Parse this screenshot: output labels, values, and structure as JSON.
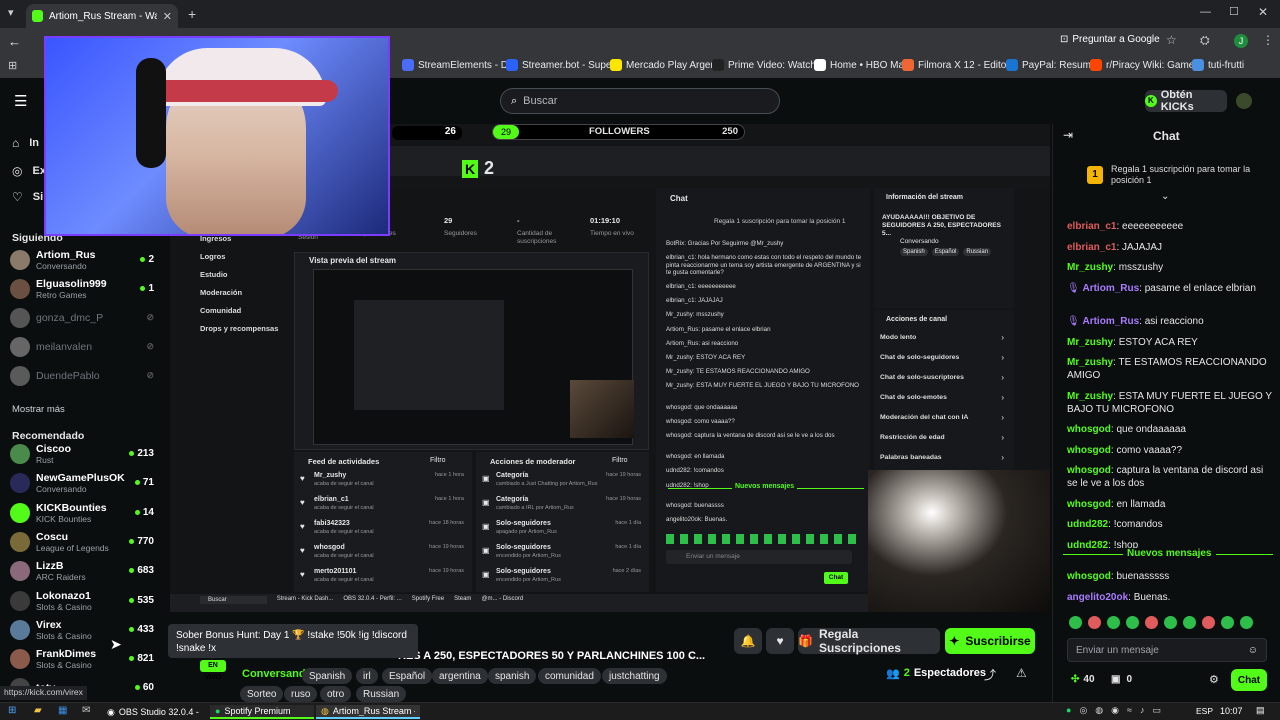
{
  "browser": {
    "tab_title": "Artiom_Rus Stream - Watch Liv",
    "ask_google": "Preguntar a Google",
    "bookmarks": [
      "StreamElements - D...",
      "Streamer.bot - Supe...",
      "Mercado Play Argen...",
      "Prime Video: Watch...",
      "Home • HBO Max",
      "Filmora X 12 - Edito...",
      "PayPal: Resumen",
      "r/Piracy Wiki: Game...",
      "tuti-frutti"
    ],
    "avatar_letter": "J",
    "status_url": "https://kick.com/virex"
  },
  "header": {
    "search_placeholder": "Buscar",
    "get_kicks": "Obtén KICKs"
  },
  "sidebar": {
    "nav": [
      "In",
      "Ex",
      "Si"
    ],
    "following_title": "Siguiendo",
    "following": [
      {
        "name": "Artiom_Rus",
        "sub": "Conversando",
        "count": "2",
        "online": true,
        "color": "#8a7a6a"
      },
      {
        "name": "Elguasolin999",
        "sub": "Retro Games",
        "count": "1",
        "online": true,
        "color": "#6a5040"
      },
      {
        "name": "gonza_dmc_P",
        "sub": "",
        "count": "",
        "online": false,
        "color": "#555"
      },
      {
        "name": "meilanvalen",
        "sub": "",
        "count": "",
        "online": false,
        "color": "#666"
      },
      {
        "name": "DuendePablo",
        "sub": "",
        "count": "",
        "online": false,
        "color": "#5a5a5a"
      }
    ],
    "show_more": "Mostrar más",
    "recommended_title": "Recomendado",
    "recommended": [
      {
        "name": "Ciscoo",
        "sub": "Rust",
        "count": "213",
        "color": "#4a8a4a"
      },
      {
        "name": "NewGamePlusOK",
        "sub": "Conversando",
        "count": "71",
        "color": "#2a2a5a"
      },
      {
        "name": "KICKBounties",
        "sub": "KICK Bounties",
        "count": "14",
        "color": "#53fc18"
      },
      {
        "name": "Coscu",
        "sub": "League of Legends",
        "count": "770",
        "color": "#7a6a3a"
      },
      {
        "name": "LizzB",
        "sub": "ARC Raiders",
        "count": "683",
        "color": "#8a6a7a"
      },
      {
        "name": "Lokonazo1",
        "sub": "Slots & Casino",
        "count": "535",
        "color": "#3a3a3a"
      },
      {
        "name": "Virex",
        "sub": "Slots & Casino",
        "count": "433",
        "color": "#5a7a9a"
      },
      {
        "name": "FrankDimes",
        "sub": "Slots & Casino",
        "count": "821",
        "color": "#8a5a4a"
      },
      {
        "name": "totv",
        "sub": "",
        "count": "60",
        "color": "#444"
      }
    ],
    "tooltip": "Sober Bonus Hunt: Day 1 🏆 !stake !50k !ig !discord !snake !x"
  },
  "stream": {
    "top_counter": "26",
    "followers_label": "FOLLOWERS",
    "followers_left": "29",
    "followers_right": "250",
    "inner_k": "2",
    "inner_menu": [
      "Ingresos",
      "Logros",
      "Estudio",
      "Moderación",
      "Comunidad",
      "Drops y recompensas"
    ],
    "stats": [
      {
        "v": "29",
        "l": "Seguidores"
      },
      {
        "v": "-",
        "l": "Cantidad de suscripciones"
      },
      {
        "v": "01:19:10",
        "l": "Tiempo en vivo"
      }
    ],
    "stats_left_label": "Sesión",
    "stats_first_label": "Espectadores",
    "preview_title": "Vista previa del stream",
    "feed_title": "Feed de actividades",
    "filter": "Filtro",
    "feed": [
      {
        "n": "Mr_zushy",
        "s": "acaba de seguir el canal",
        "t": "hace 1 hora"
      },
      {
        "n": "elbrian_c1",
        "s": "acaba de seguir el canal",
        "t": "hace 1 hora"
      },
      {
        "n": "fabi342323",
        "s": "acaba de seguir el canal",
        "t": "hace 18 horas"
      },
      {
        "n": "whosgod",
        "s": "acaba de seguir el canal",
        "t": "hace 19 horas"
      },
      {
        "n": "merto201101",
        "s": "acaba de seguir el canal",
        "t": "hace 19 horas"
      }
    ],
    "mod_title": "Acciones de moderador",
    "mod": [
      {
        "n": "Categoría",
        "s": "cambiado a Just Chatting por Artiom_Rus",
        "t": "hace 19 horas"
      },
      {
        "n": "Categoría",
        "s": "cambiado a IRL por Artiom_Rus",
        "t": "hace 19 horas"
      },
      {
        "n": "Solo-seguidores",
        "s": "apagado por Artiom_Rus",
        "t": "hace 1 día"
      },
      {
        "n": "Solo-seguidores",
        "s": "encendido por Artiom_Rus",
        "t": "hace 1 día"
      },
      {
        "n": "Solo-seguidores",
        "s": "encendido por Artiom_Rus",
        "t": "hace 2 días"
      }
    ],
    "inner_chat_title": "Chat",
    "inner_chat_banner": "Regala 1 suscripción para tomar la posición 1",
    "inner_chat": [
      "BotRix: Gracias Por Seguirme @Mr_zushy",
      "elbrian_c1: hola hermano como estas con todo el respeto del mundo te pinta reaccionarme un tema soy artista emergente de ARGENTINA y si te gusta comentarle?",
      "elbrian_c1: eeeeeeeeeee",
      "elbrian_c1: JAJAJAJ",
      "Mr_zushy: msszushy",
      "Artiom_Rus: pasame el enlace elbrian",
      "Artiom_Rus: asi reacciono",
      "Mr_zushy: ESTOY ACA REY",
      "Mr_zushy: TE ESTAMOS REACCIONANDO AMIGO",
      "Mr_zushy: ESTA MUY FUERTE EL JUEGO Y BAJO TU MICROFONO",
      "whosgod: que ondaaaaaa",
      "whosgod: como vaaaa??",
      "whosgod: captura la ventana de discord asi se le ve a los dos",
      "whosgod: en llamada",
      "udnd282: !comandos",
      "udnd282: !shop"
    ],
    "inner_new": "Nuevos mensajes",
    "inner_new_msgs": [
      "whosgod: buenassss",
      "angelito20ok: Buenas."
    ],
    "inner_send": "Enviar un mensaje",
    "inner_chat_btn": "Chat",
    "info_title": "Información del stream",
    "info_text": "AYUDAAAAA!!! OBJETIVO DE SEGUIDORES A 250, ESPECTADORES 5...",
    "info_cat": "Conversando",
    "info_tags": [
      "Spanish",
      "Español",
      "Russian"
    ],
    "actions_title": "Acciones de canal",
    "actions": [
      "Modo lento",
      "Chat de solo-seguidores",
      "Chat de solo-suscriptores",
      "Chat de solo-emotes",
      "Moderación del chat con IA",
      "Restricción de edad",
      "Palabras baneadas"
    ],
    "inner_taskbar": [
      "Buscar",
      "Stream - Kick Dash...",
      "OBS 32.0.4 - Perfil: ...",
      "Spotify Free",
      "Steam",
      "@m... - Discord"
    ]
  },
  "below": {
    "live_badge": "EN VIVO",
    "title": "RES A 250, ESPECTADORES 50 Y PARLANCHINES 100 C...",
    "category": "Conversando",
    "tags": [
      "Spanish",
      "irl",
      "Español",
      "argentina",
      "spanish",
      "comunidad",
      "justchatting",
      "Sorteo",
      "ruso",
      "otro",
      "Russian"
    ],
    "gift_subs": "Regala Suscripciones",
    "subscribe": "Suscribirse",
    "viewers_count": "2",
    "viewers_label": "Espectadores"
  },
  "chat": {
    "title": "Chat",
    "banner": "Regala 1 suscripción para tomar la posición 1",
    "banner_rank": "1",
    "messages": [
      {
        "u": "elbrian_c1",
        "t": "eeeeeeeeeee",
        "c": "u2"
      },
      {
        "u": "elbrian_c1",
        "t": "JAJAJAJ",
        "c": "u2"
      },
      {
        "u": "Mr_zushy",
        "t": "msszushy",
        "c": "u1"
      },
      {
        "u": "Artiom_Rus",
        "t": "pasame el enlace elbrian",
        "c": "u3"
      },
      {
        "u": "Artiom_Rus",
        "t": "asi reacciono",
        "c": "u3"
      },
      {
        "u": "Mr_zushy",
        "t": "ESTOY ACA REY",
        "c": "u1"
      },
      {
        "u": "Mr_zushy",
        "t": "TE ESTAMOS REACCIONANDO AMIGO",
        "c": "u1"
      },
      {
        "u": "Mr_zushy",
        "t": "ESTA MUY FUERTE EL JUEGO Y BAJO TU MICROFONO",
        "c": "u1"
      },
      {
        "u": "whosgod",
        "t": "que ondaaaaaa",
        "c": "u4"
      },
      {
        "u": "whosgod",
        "t": "como vaaaa??",
        "c": "u4"
      },
      {
        "u": "whosgod",
        "t": "captura la ventana de discord asi se le ve a los dos",
        "c": "u4"
      },
      {
        "u": "whosgod",
        "t": "en llamada",
        "c": "u4"
      },
      {
        "u": "udnd282",
        "t": "!comandos",
        "c": "u4"
      },
      {
        "u": "udnd282",
        "t": "!shop",
        "c": "u4"
      }
    ],
    "new_messages": "Nuevos mensajes",
    "after_new": [
      {
        "u": "whosgod",
        "t": "buenasssss",
        "c": "u4"
      },
      {
        "u": "angelito20ok",
        "t": "Buenas.",
        "c": "u3"
      }
    ],
    "input_placeholder": "Enviar un mensaje",
    "kicks": "40",
    "points": "0",
    "send": "Chat"
  },
  "taskbar": {
    "apps": [
      "OBS Studio 32.0.4 - P...",
      "Spotify Premium",
      "Artiom_Rus Stream -..."
    ],
    "lang": "ESP",
    "time": "10:07"
  },
  "colors": {
    "kick_green": "#53fc18",
    "bg": "#0b0e0f"
  }
}
